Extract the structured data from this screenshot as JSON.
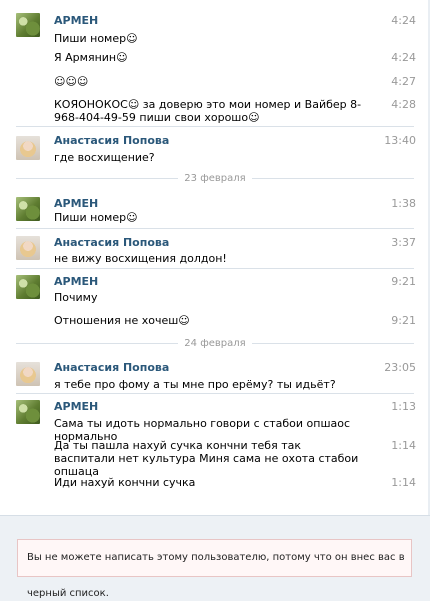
{
  "messages": [
    {
      "author": "АРМЕН",
      "time": "4:24",
      "text": "Пиши номер☺"
    },
    {
      "time": "4:24",
      "text": "Я Армянин☺"
    },
    {
      "time": "4:27",
      "text": "☺☺☺"
    },
    {
      "time": "4:28",
      "text": "КОЯОНОКОС☺ за доверю это мои номер и Вайбер 8-968-404-49-59 пиши свои хорошо☺"
    },
    {
      "author": "Анастасия Попова",
      "time": "13:40",
      "text": "где восхищение?"
    }
  ],
  "date1": "23 февраля",
  "messages2": [
    {
      "author": "АРМЕН",
      "time": "1:38",
      "text": "Пиши номер☺"
    },
    {
      "author": "Анастасия Попова",
      "time": "3:37",
      "text": "не вижу восхищения долдон!"
    },
    {
      "author": "АРМЕН",
      "time": "9:21",
      "text": "Почиму"
    },
    {
      "time": "9:21",
      "text": "Отношения не хочеш☺"
    }
  ],
  "date2": "24 февраля",
  "messages3": [
    {
      "author": "Анастасия Попова",
      "time": "23:05",
      "text": "я тебе про фому а ты мне про ерёму? ты идьёт?"
    },
    {
      "author": "АРМЕН",
      "time": "1:13",
      "text": "Сама ты идоть нормально говори с стабои опшаос нормально"
    },
    {
      "time": "1:14",
      "text": "Да ты пашла нахуй сучка кончни тебя так васпитали нет культура Миня сама не охота стабои опшаца"
    },
    {
      "time": "1:14",
      "text": "Иди нахуй кончни сучка"
    }
  ],
  "warning": "Вы не можете написать этому пользователю, потому что он внес вас в черный список.",
  "colors": {
    "author": "#2b587a",
    "time": "#999999",
    "separator": "#dae1e8",
    "footer": "#edf1f5",
    "warning_bg": "#fff7f7",
    "warning_border": "#e8c5c5"
  }
}
